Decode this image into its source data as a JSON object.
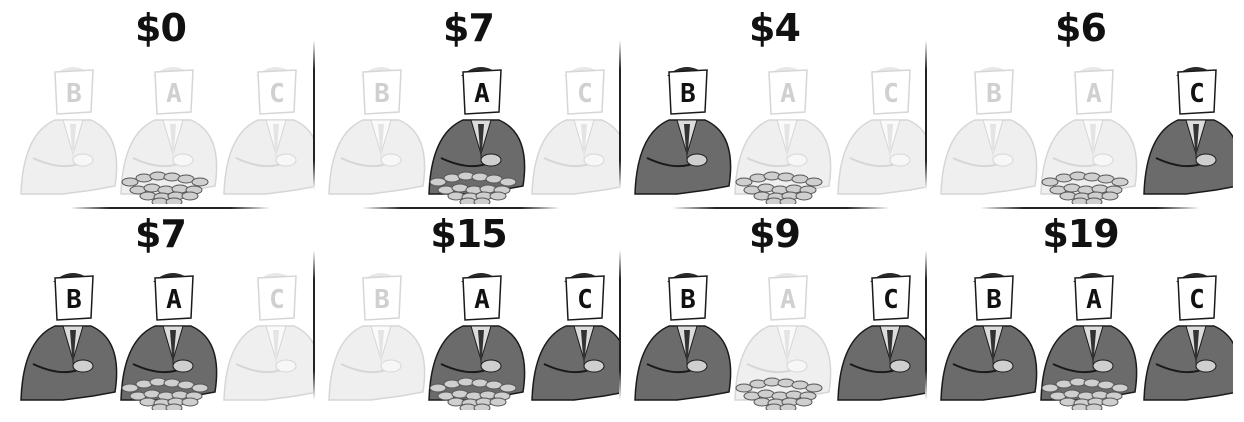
{
  "panels": [
    {
      "amount": "$0",
      "active": {
        "B": false,
        "A": false,
        "C": false
      }
    },
    {
      "amount": "$7",
      "active": {
        "B": false,
        "A": true,
        "C": false
      }
    },
    {
      "amount": "$4",
      "active": {
        "B": true,
        "A": false,
        "C": false
      }
    },
    {
      "amount": "$6",
      "active": {
        "B": false,
        "A": false,
        "C": true
      }
    },
    {
      "amount": "$7",
      "active": {
        "B": true,
        "A": true,
        "C": false
      }
    },
    {
      "amount": "$15",
      "active": {
        "B": false,
        "A": true,
        "C": true
      }
    },
    {
      "amount": "$9",
      "active": {
        "B": true,
        "A": false,
        "C": true
      }
    },
    {
      "amount": "$19",
      "active": {
        "B": true,
        "A": true,
        "C": true
      }
    }
  ],
  "player_labels": [
    "B",
    "A",
    "C"
  ],
  "colors": {
    "active_suit": "#6b6b6b",
    "active_line": "#1a1a1a",
    "faded_suit": "#efefef",
    "faded_line": "#d6d6d6",
    "coin": "#9a9a9a"
  }
}
